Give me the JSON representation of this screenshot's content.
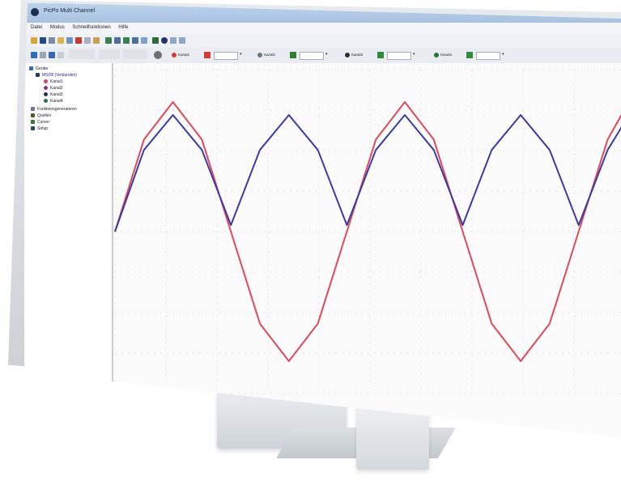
{
  "window": {
    "title": "PicPo Multi Channel"
  },
  "menu": [
    {
      "label": "Datei"
    },
    {
      "label": "Modus"
    },
    {
      "label": "Schnellfunktionen"
    },
    {
      "label": "Hilfe"
    }
  ],
  "channels": [
    {
      "name": "Kanal1",
      "color": "#d83a3a"
    },
    {
      "name": "Kanal2",
      "color": "#2e7d32"
    },
    {
      "name": "Kanal3",
      "color": "#263238"
    },
    {
      "name": "Kanal4",
      "color": "#1b5e20"
    }
  ],
  "tree": {
    "root": {
      "label": "Geräte"
    },
    "device": {
      "label": "MSO8 (Verbunden)"
    },
    "channels": [
      {
        "label": "Kanal1",
        "color": "#c44a6a"
      },
      {
        "label": "Kanal2",
        "color": "#7a3a8a"
      },
      {
        "label": "Kanal3",
        "color": "#2b2b5a"
      },
      {
        "label": "Kanal4",
        "color": "#1f6f5a"
      }
    ],
    "others": [
      {
        "label": "Funktionsgeneratoren"
      },
      {
        "label": "Quellen"
      },
      {
        "label": "Cursor"
      },
      {
        "label": "Setup"
      }
    ]
  },
  "chart_data": {
    "type": "line",
    "grid": true,
    "xlim": [
      0,
      4.4
    ],
    "ylim": [
      -1.25,
      1.25
    ],
    "series": [
      {
        "color": "#e0485a",
        "x": [
          0,
          0.25,
          0.5,
          0.75,
          1.0,
          1.25,
          1.5,
          1.75,
          2.0,
          2.25,
          2.5,
          2.75,
          3.0,
          3.25,
          3.5,
          3.75,
          4.0,
          4.25,
          4.4
        ],
        "y": [
          0,
          0.71,
          1.0,
          0.71,
          0,
          -0.71,
          -1.0,
          -0.71,
          0,
          0.71,
          1.0,
          0.71,
          0,
          -0.71,
          -1.0,
          -0.71,
          0,
          0.71,
          0.95
        ]
      },
      {
        "color": "#3a3aa0",
        "x": [
          0,
          0.25,
          0.5,
          0.75,
          1.0,
          1.25,
          1.5,
          1.75,
          2.0,
          2.25,
          2.5,
          2.75,
          3.0,
          3.25,
          3.5,
          3.75,
          4.0,
          4.25,
          4.4
        ],
        "y": [
          0,
          0.63,
          0.9,
          0.63,
          0.05,
          0.63,
          0.9,
          0.63,
          0.05,
          0.63,
          0.9,
          0.63,
          0.05,
          0.63,
          0.9,
          0.63,
          0.05,
          0.63,
          0.85
        ]
      }
    ]
  }
}
